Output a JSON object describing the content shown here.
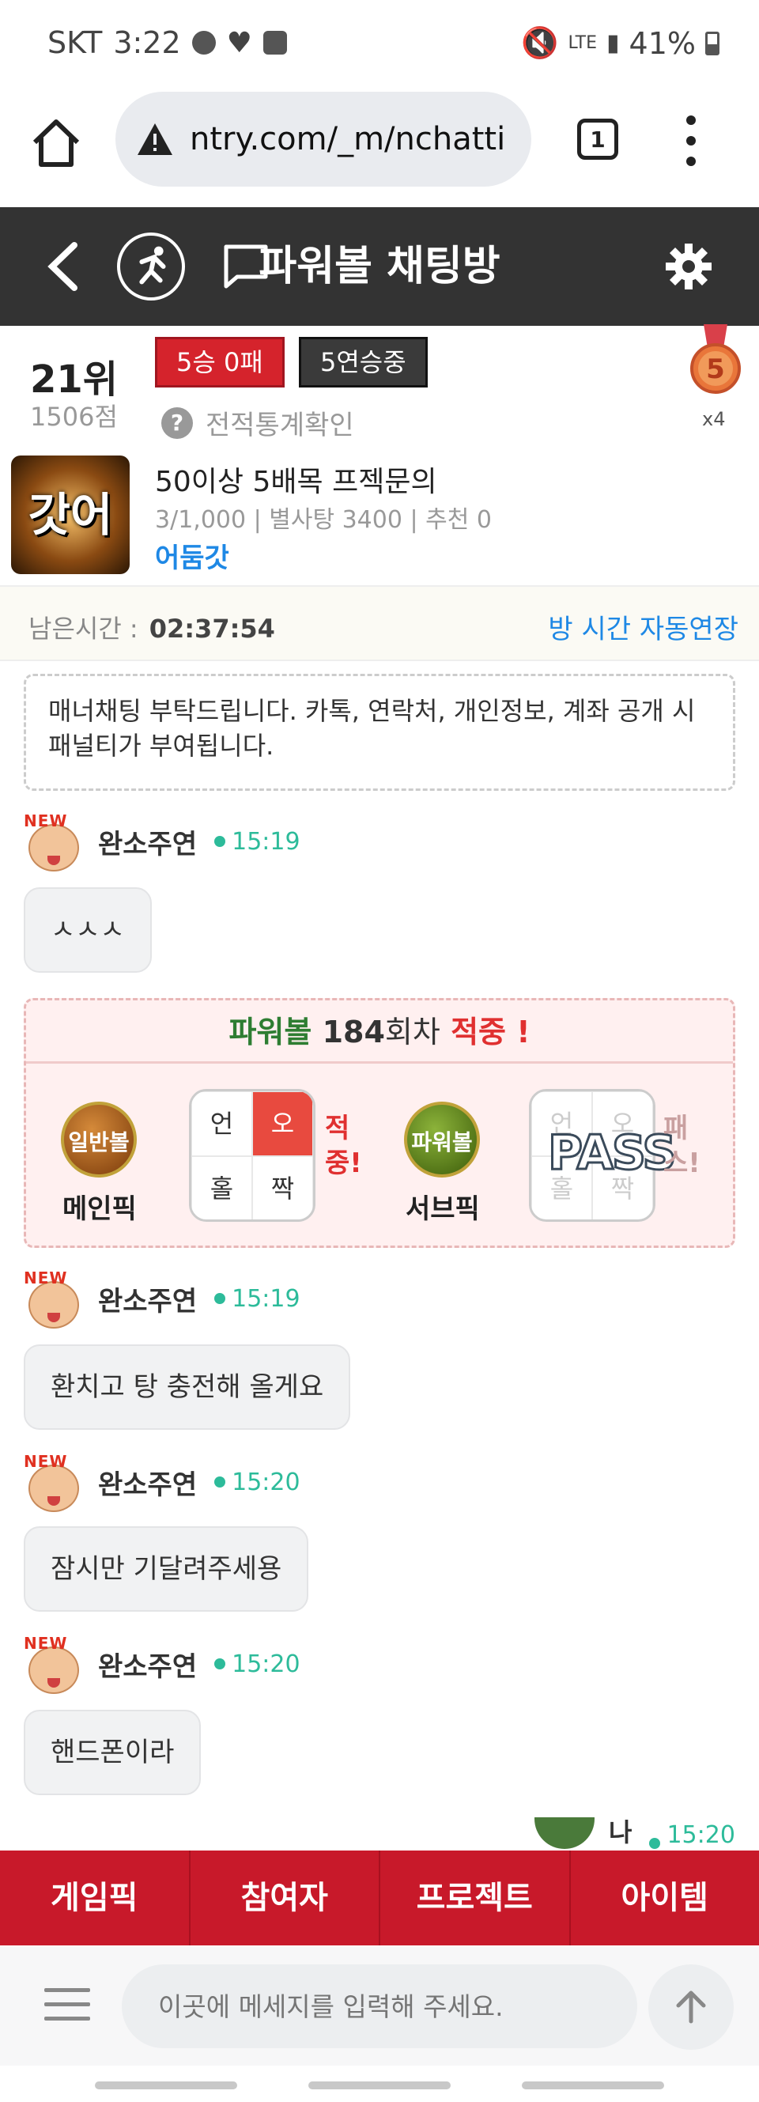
{
  "status_bar": {
    "carrier": "SKT",
    "time": "3:22",
    "network": "LTE",
    "battery": "41%"
  },
  "browser": {
    "url": "ntry.com/_m/nchatti",
    "tab_count": "1"
  },
  "app_bar": {
    "title": "파워볼 채팅방"
  },
  "room_owner_stats": {
    "rank": "21위",
    "score": "1506점",
    "record_badge": "5승 0패",
    "streak_badge": "5연승중",
    "stats_link": "전적통계확인",
    "medal_level": "5",
    "medal_count": "x4"
  },
  "room": {
    "thumbnail_text": "갓어둠",
    "name": "50이상 5배목 프젝문의",
    "meta": "3/1,000 | 별사탕 3400 | 추천 0",
    "owner": "어둠갓"
  },
  "timer": {
    "label": "남은시간 :",
    "value": "02:37:54",
    "extend_label": "방 시간 자동연장"
  },
  "notice": "매너채팅 부탁드립니다. 카톡, 연락처, 개인정보, 계좌 공개 시 패널티가 부여됩니다.",
  "messages": [
    {
      "user": "완소주연",
      "time": "15:19",
      "text": "ㅅㅅㅅ",
      "badge": "NEW"
    },
    {
      "user": "완소주연",
      "time": "15:19",
      "text": "환치고 탕 충전해 올게요",
      "badge": "NEW"
    },
    {
      "user": "완소주연",
      "time": "15:20",
      "text": "잠시만 기달려주세용",
      "badge": "NEW"
    },
    {
      "user": "완소주연",
      "time": "15:20",
      "text": "핸드폰이라",
      "badge": "NEW"
    }
  ],
  "result_card": {
    "game": "파워볼",
    "round": "184",
    "round_suffix": "회차",
    "status": "적중 !",
    "main_pick": {
      "icon_text": "일반볼",
      "label": "메인픽",
      "cells": [
        "언",
        "오",
        "홀",
        "짝"
      ],
      "selected": "오",
      "verdict": "적중!"
    },
    "sub_pick": {
      "icon_text": "파워볼",
      "label": "서브픽",
      "cells": [
        "언",
        "오",
        "홀",
        "짝"
      ],
      "overlay": "PASS",
      "verdict": "패스!"
    }
  },
  "my_message": {
    "user": "나",
    "time": "15:20"
  },
  "bottom_nav": [
    "게임픽",
    "참여자",
    "프로젝트",
    "아이템"
  ],
  "input": {
    "placeholder": "이곳에 메세지를 입력해 주세요."
  },
  "colors": {
    "accent_red": "#c8192a",
    "app_bar": "#333333",
    "time_green": "#2dbb9a",
    "link_blue": "#1e88e5"
  }
}
